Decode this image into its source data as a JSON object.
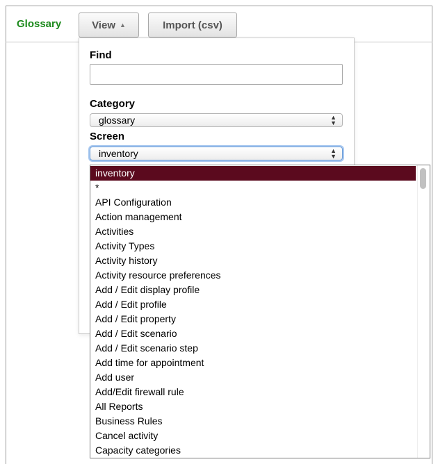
{
  "app": {
    "title": "Glossary"
  },
  "toolbar": {
    "view_label": "View",
    "import_label": "Import (csv)"
  },
  "filters": {
    "find_label": "Find",
    "find_value": "",
    "category_label": "Category",
    "category_value": "glossary",
    "screen_label": "Screen",
    "screen_value": "inventory"
  },
  "screen_options": [
    "inventory",
    "*",
    "API Configuration",
    "Action management",
    "Activities",
    "Activity Types",
    "Activity history",
    "Activity resource preferences",
    "Add / Edit display profile",
    "Add / Edit profile",
    "Add / Edit property",
    "Add / Edit scenario",
    "Add / Edit scenario step",
    "Add time for appointment",
    "Add user",
    "Add/Edit firewall rule",
    "All Reports",
    "Business Rules",
    "Cancel activity",
    "Capacity categories"
  ],
  "colors": {
    "brand": "#1c8a1c",
    "selected_bg": "#5b0a1e",
    "focus_ring": "#a8c8f0"
  },
  "icons": {
    "view_toggle": "triangle-up-icon",
    "select_arrows": "updown-arrows-icon"
  }
}
